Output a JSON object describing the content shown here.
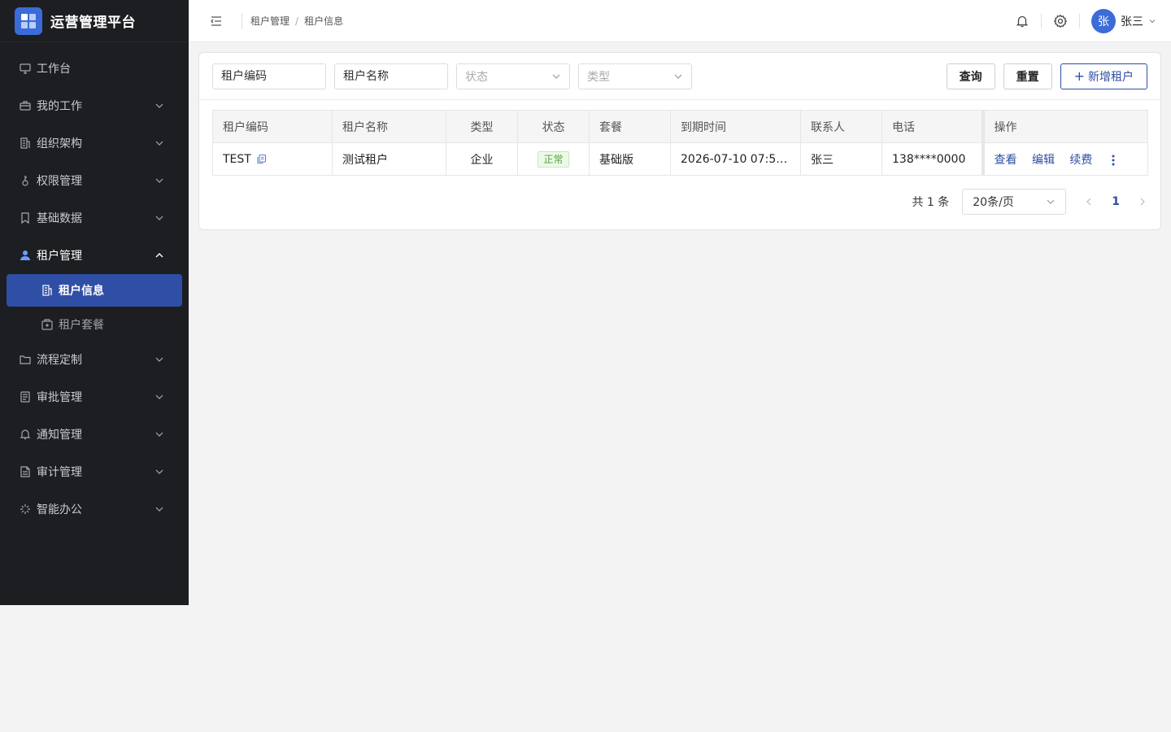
{
  "brand": {
    "title": "运营管理平台"
  },
  "sidebar": {
    "items": [
      {
        "label": "工作台",
        "icon": "monitor-icon"
      },
      {
        "label": "我的工作",
        "icon": "briefcase-icon"
      },
      {
        "label": "组织架构",
        "icon": "building-icon"
      },
      {
        "label": "权限管理",
        "icon": "key-icon"
      },
      {
        "label": "基础数据",
        "icon": "bookmark-icon"
      },
      {
        "label": "租户管理",
        "icon": "user-icon"
      },
      {
        "label": "流程定制",
        "icon": "folder-icon"
      },
      {
        "label": "审批管理",
        "icon": "document-icon"
      },
      {
        "label": "通知管理",
        "icon": "bell-icon"
      },
      {
        "label": "审计管理",
        "icon": "file-icon"
      },
      {
        "label": "智能办公",
        "icon": "sparkle-icon"
      }
    ],
    "tenant_sub": [
      {
        "label": "租户信息",
        "icon": "building-icon"
      },
      {
        "label": "租户套餐",
        "icon": "package-icon"
      }
    ]
  },
  "header": {
    "breadcrumb": [
      "租户管理",
      "租户信息"
    ],
    "breadcrumb_sep": "/",
    "user": {
      "avatar": "张",
      "name": "张三"
    }
  },
  "filters": {
    "code_placeholder": "租户编码",
    "name_placeholder": "租户名称",
    "status_placeholder": "状态",
    "type_placeholder": "类型",
    "query_label": "查询",
    "reset_label": "重置",
    "add_label": "新增租户"
  },
  "table": {
    "columns": [
      "租户编码",
      "租户名称",
      "类型",
      "状态",
      "套餐",
      "到期时间",
      "联系人",
      "电话",
      "操作"
    ],
    "rows": [
      {
        "code": "TEST",
        "name": "测试租户",
        "type": "企业",
        "status": "正常",
        "plan": "基础版",
        "expire": "2026-07-10 07:50...",
        "contact": "张三",
        "phone": "138****0000",
        "ops": [
          "查看",
          "编辑",
          "续费"
        ]
      }
    ]
  },
  "pagination": {
    "total": "共 1 条",
    "page_size": "20条/页",
    "current_page": "1"
  },
  "colors": {
    "sidebar_bg": "#1d1e22",
    "active_bg": "#2f4ea5",
    "brand_accent": "#3a6bd8",
    "status_ok": "#52a43a"
  }
}
